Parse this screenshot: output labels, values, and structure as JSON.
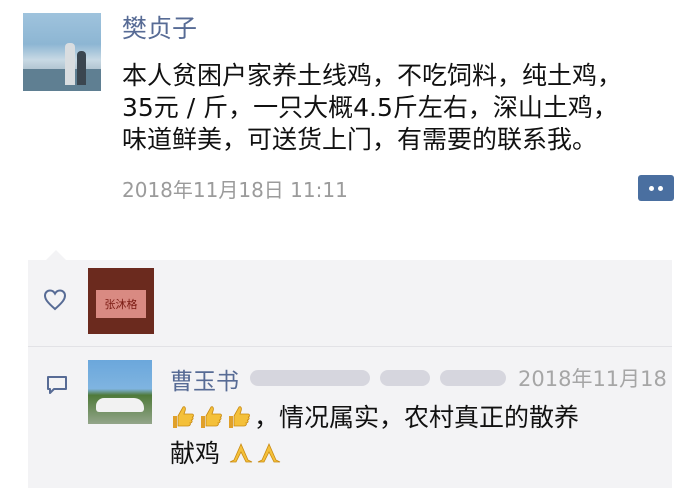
{
  "post": {
    "author": "樊贞子",
    "content_lines": [
      "本人贫困户家养土线鸡，不吃饲料，纯土鸡，",
      "35元 / 斤，一只大概4.5斤左右，深山土鸡，",
      "味道鲜美，可送货上门，有需要的联系我。"
    ],
    "timestamp": "2018年11月18日  11:11"
  },
  "likes": {
    "icon": "heart-icon",
    "avatar_card_text": "张沐格"
  },
  "comments": [
    {
      "author": "曹玉书",
      "timestamp": "2018年11月18",
      "text": "，情况属实，农村真正的散养",
      "text_line2": "献鸡",
      "leading_emoji": "thumbs-up-icon",
      "trailing_emoji": "praying-hands-icon"
    }
  ],
  "colors": {
    "name_blue": "#576b95",
    "interaction_bg": "#f3f3f5",
    "more_button": "#4a6fa0"
  }
}
